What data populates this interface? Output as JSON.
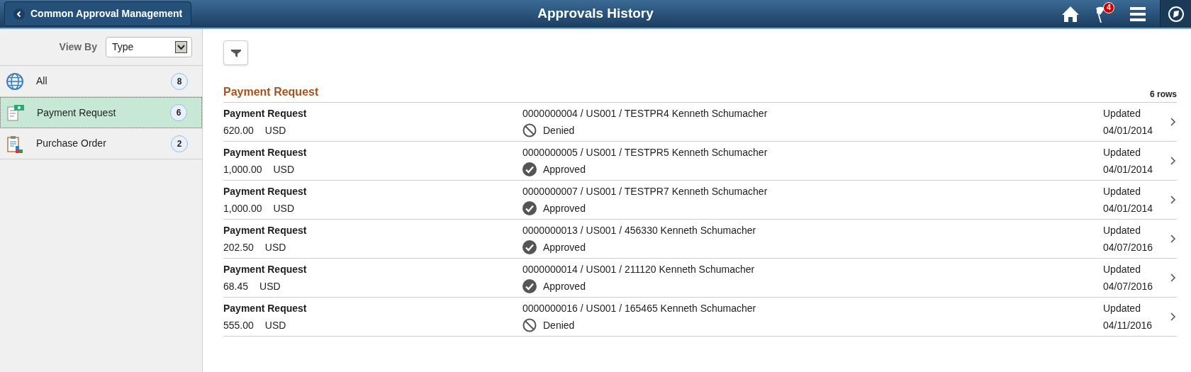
{
  "header": {
    "back_button": "Common Approval Management",
    "title": "Approvals History",
    "notification_count": "4"
  },
  "sidebar": {
    "view_by_label": "View By",
    "view_by_value": "Type",
    "items": [
      {
        "label": "All",
        "count": "8",
        "kind": "all",
        "selected": false
      },
      {
        "label": "Payment Request",
        "count": "6",
        "kind": "payment",
        "selected": true
      },
      {
        "label": "Purchase Order",
        "count": "2",
        "kind": "order",
        "selected": false
      }
    ]
  },
  "group": {
    "title": "Payment Request",
    "row_count": "6 rows",
    "rows": [
      {
        "title": "Payment Request",
        "amount": "620.00",
        "currency": "USD",
        "reference": "0000000004 / US001 / TESTPR4 Kenneth Schumacher",
        "status": "Denied",
        "kind": "denied",
        "updated_label": "Updated",
        "date": "04/01/2014"
      },
      {
        "title": "Payment Request",
        "amount": "1,000.00",
        "currency": "USD",
        "reference": "0000000005 / US001 / TESTPR5 Kenneth Schumacher",
        "status": "Approved",
        "kind": "approved",
        "updated_label": "Updated",
        "date": "04/01/2014"
      },
      {
        "title": "Payment Request",
        "amount": "1,000.00",
        "currency": "USD",
        "reference": "0000000007 / US001 / TESTPR7 Kenneth Schumacher",
        "status": "Approved",
        "kind": "approved",
        "updated_label": "Updated",
        "date": "04/01/2014"
      },
      {
        "title": "Payment Request",
        "amount": "202.50",
        "currency": "USD",
        "reference": "0000000013 / US001 / 456330 Kenneth Schumacher",
        "status": "Approved",
        "kind": "approved",
        "updated_label": "Updated",
        "date": "04/07/2016"
      },
      {
        "title": "Payment Request",
        "amount": "68.45",
        "currency": "USD",
        "reference": "0000000014 / US001 / 211120 Kenneth Schumacher",
        "status": "Approved",
        "kind": "approved",
        "updated_label": "Updated",
        "date": "04/07/2016"
      },
      {
        "title": "Payment Request",
        "amount": "555.00",
        "currency": "USD",
        "reference": "0000000016 / US001 / 165465 Kenneth Schumacher",
        "status": "Denied",
        "kind": "denied",
        "updated_label": "Updated",
        "date": "04/11/2016"
      }
    ]
  }
}
